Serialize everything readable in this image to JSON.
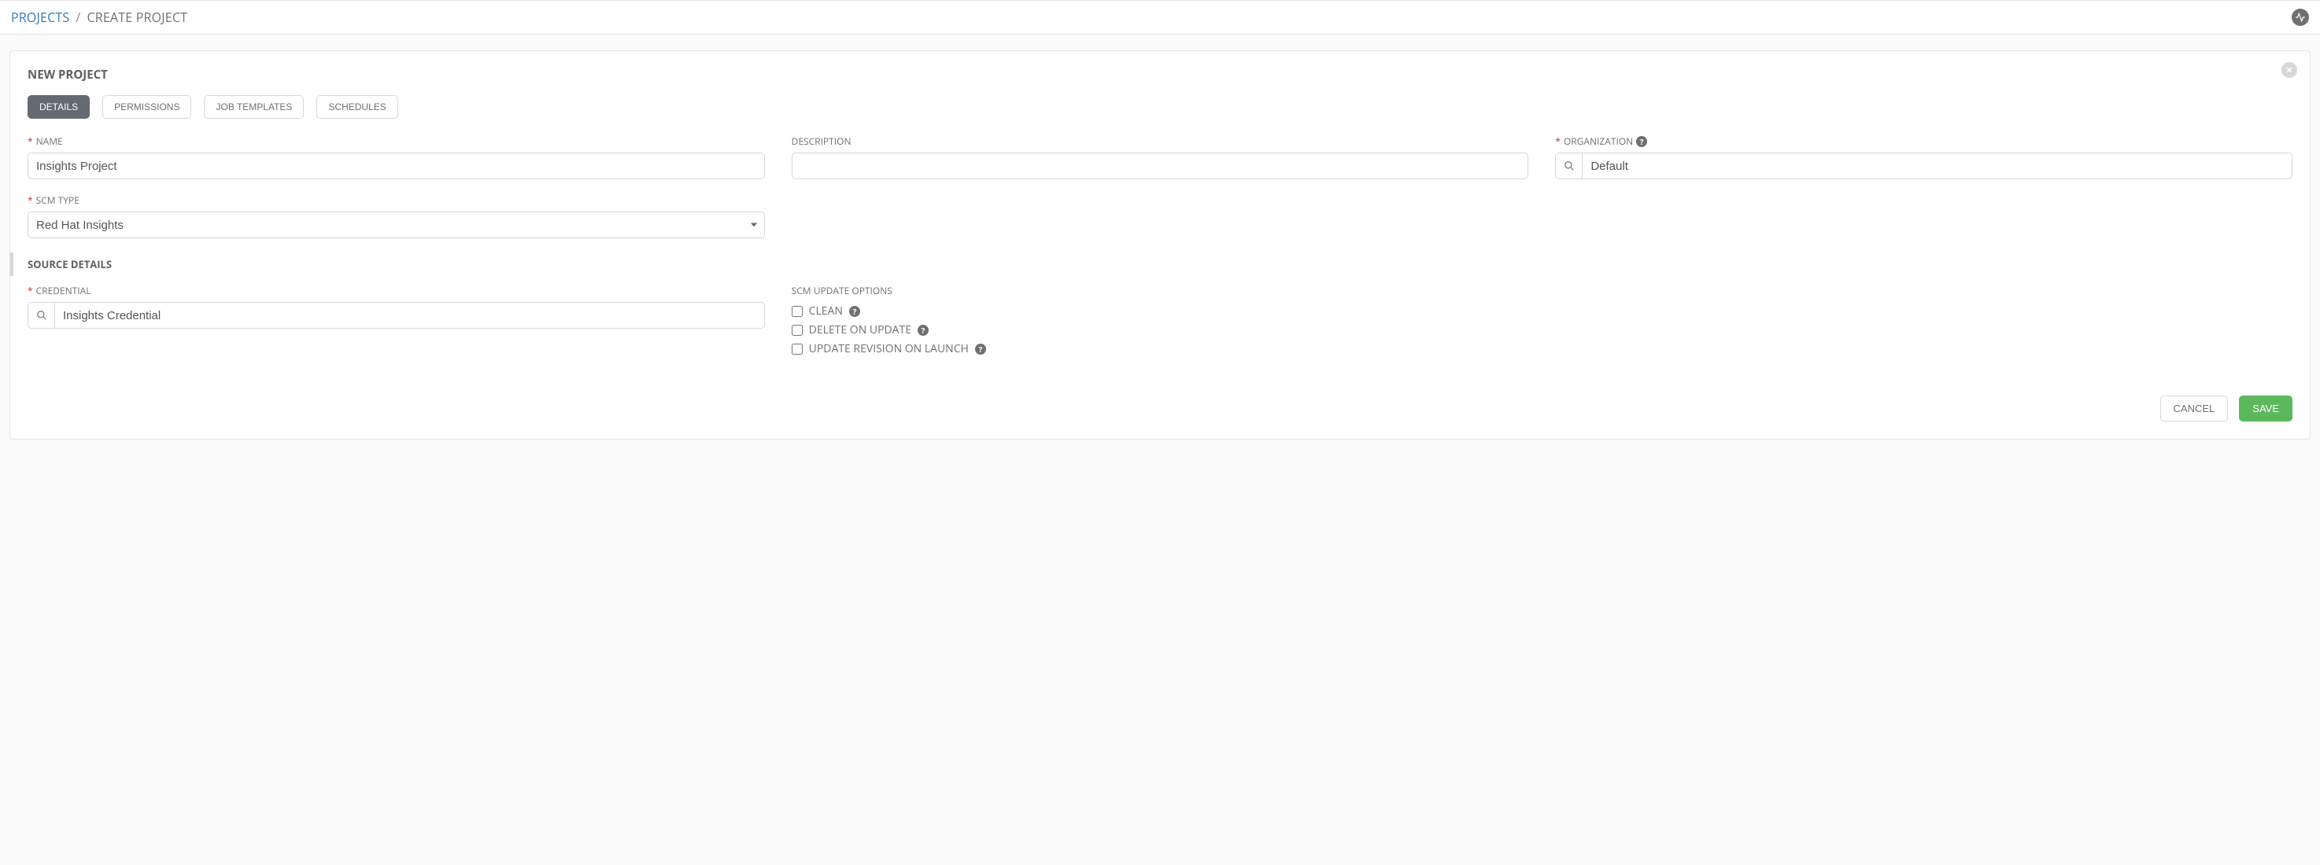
{
  "breadcrumb": {
    "root": "PROJECTS",
    "current": "CREATE PROJECT"
  },
  "panel": {
    "title": "NEW PROJECT"
  },
  "tabs": [
    {
      "label": "DETAILS"
    },
    {
      "label": "PERMISSIONS"
    },
    {
      "label": "JOB TEMPLATES"
    },
    {
      "label": "SCHEDULES"
    }
  ],
  "fields": {
    "name": {
      "label": "NAME",
      "value": "Insights Project"
    },
    "description": {
      "label": "DESCRIPTION",
      "value": ""
    },
    "organization": {
      "label": "ORGANIZATION",
      "value": "Default"
    },
    "scm_type": {
      "label": "SCM TYPE",
      "value": "Red Hat Insights"
    }
  },
  "source": {
    "header": "SOURCE DETAILS",
    "credential": {
      "label": "CREDENTIAL",
      "value": "Insights Credential"
    },
    "update_options": {
      "label": "SCM UPDATE OPTIONS",
      "clean": "CLEAN",
      "delete_on_update": "DELETE ON UPDATE",
      "update_on_launch": "UPDATE REVISION ON LAUNCH"
    }
  },
  "buttons": {
    "cancel": "CANCEL",
    "save": "SAVE"
  }
}
